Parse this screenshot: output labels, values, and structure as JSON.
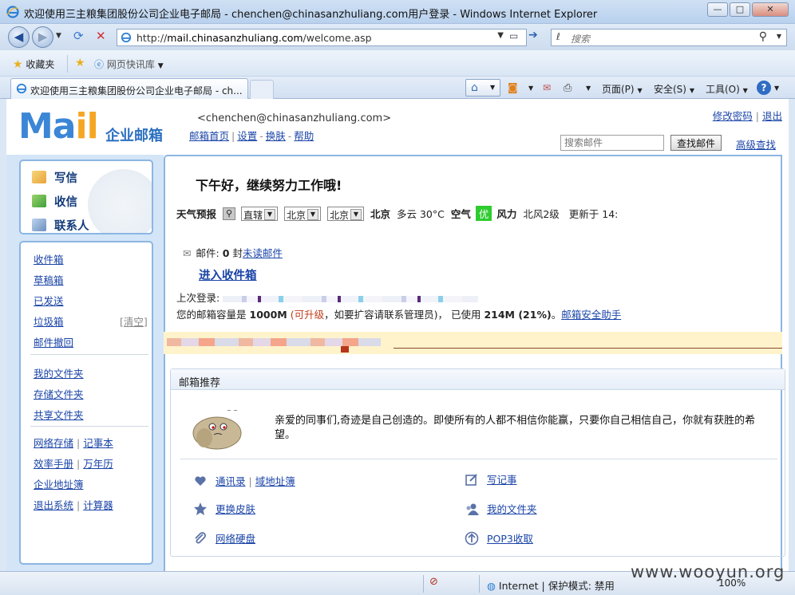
{
  "window": {
    "title": "欢迎使用三主粮集团股份公司企业电子邮局 - chenchen@chinasanzhuliang.com用户登录 - Windows Internet Explorer",
    "controls": {
      "min": "—",
      "max": "□",
      "close": "✕"
    }
  },
  "address_bar": {
    "url_prefix": "http://",
    "url_host": "mail.chinasanzhuliang.com",
    "url_path": "/welcome.asp",
    "search_placeholder": "搜索"
  },
  "favorites_bar": {
    "favorites": "收藏夹",
    "web_slice": "网页快讯库"
  },
  "tab": {
    "title": "欢迎使用三主粮集团股份公司企业电子邮局 - ch..."
  },
  "command_bar": {
    "page": "页面(P)",
    "safety": "安全(S)",
    "tools": "工具(O)",
    "help": "?"
  },
  "header": {
    "logo_main": "Ma",
    "logo_accent": "il",
    "logo_sub": "企业邮箱",
    "user_email": "<chenchen@chinasanzhuliang.com>",
    "links": [
      "邮箱首页",
      "设置",
      "换肤",
      "帮助"
    ],
    "change_password": "修改密码",
    "logout": "退出",
    "search_placeholder": "搜索邮件",
    "search_button": "查找邮件",
    "advanced_search": "高级查找"
  },
  "sidebar": {
    "primary": [
      "写信",
      "收信",
      "联系人"
    ],
    "folders": [
      "收件箱",
      "草稿箱",
      "已发送",
      "垃圾箱",
      "邮件撤回"
    ],
    "clear": "[清空]",
    "my_folders": [
      "我的文件夹",
      "存储文件夹",
      "共享文件夹"
    ],
    "tools_row1": [
      "网络存储",
      "记事本"
    ],
    "tools_row2": [
      "效率手册",
      "万年历"
    ],
    "tools_row3": [
      "企业地址簿"
    ],
    "tools_row4": [
      "退出系统",
      "计算器"
    ]
  },
  "main": {
    "greeting": "下午好，继续努力工作哦!",
    "weather": {
      "label": "天气预报",
      "mode": "直辖",
      "province": "北京",
      "city": "北京",
      "city_bold": "北京",
      "condition": "多云 30°C",
      "air_label": "空气",
      "air_value": "优",
      "wind_label": "风力",
      "wind_value": "北风2级",
      "updated": "更新于 14:"
    },
    "mail_label": "邮件:",
    "mail_count": "0",
    "mail_unit": "封",
    "unread_link": "未读邮件",
    "inbox_link": "进入收件箱",
    "last_login_label": "上次登录:",
    "quota_prefix": "您的邮箱容量是",
    "quota_total": "1000M",
    "upgradable": "(可升级",
    "quota_middle": "，如要扩容请联系管理员)，   已使用",
    "quota_used": "214M (21%)",
    "quota_suffix": "。",
    "security_link": "邮箱安全助手",
    "recommend_title": "邮箱推荐",
    "quote": "亲爱的同事们,奇迹是自己创造的。即使所有的人都不相信你能赢，只要你自己相信自己，你就有获胜的希望。",
    "links": {
      "contacts": "通讯录",
      "domain_book": "域地址簿",
      "notes": "写记事",
      "skin": "更换皮肤",
      "my_folder": "我的文件夹",
      "netdisk": "网络硬盘",
      "pop3": "POP3收取"
    }
  },
  "status_bar": {
    "zone": "Internet | 保护模式: 禁用",
    "zoom": "100%"
  },
  "watermark": "www.wooyun.org",
  "colors": {
    "accent_blue": "#3b86d6",
    "logo_orange": "#f5a623",
    "sidebar_bg": "#d3e5f7",
    "air_good": "#2ecc30",
    "link": "#1a44a8"
  }
}
